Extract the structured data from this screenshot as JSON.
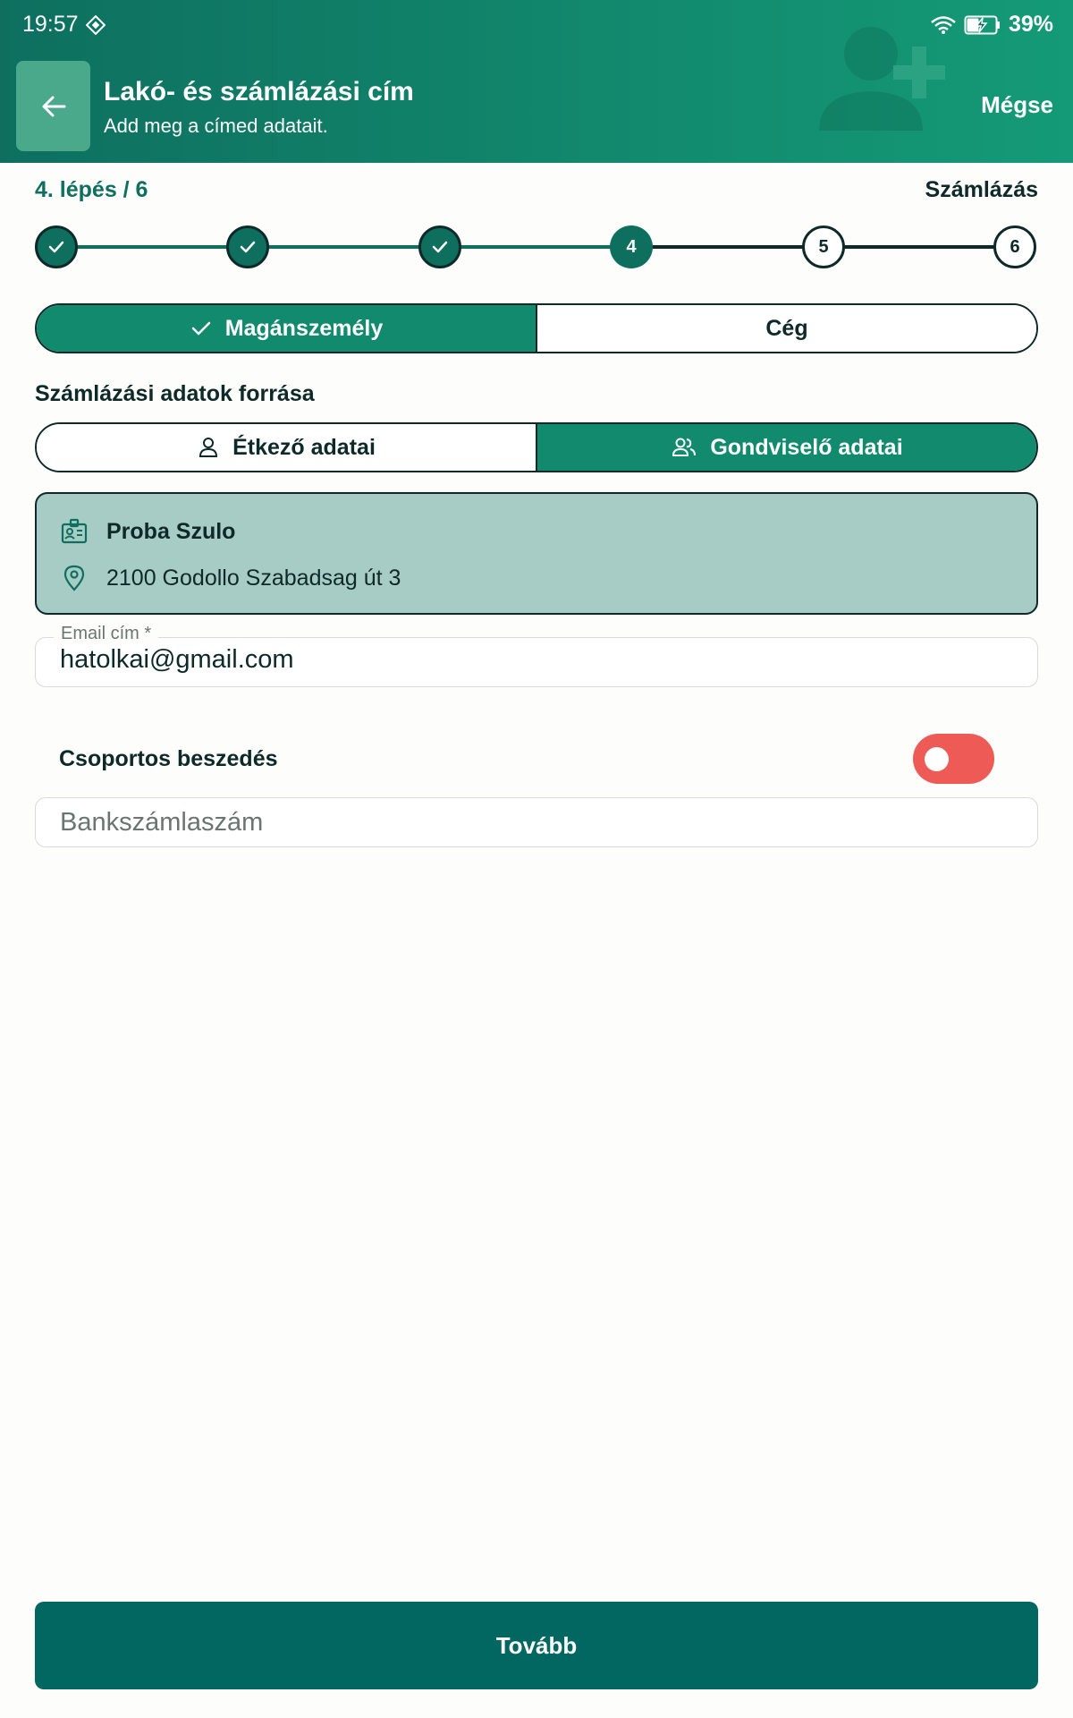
{
  "status_bar": {
    "time": "19:57",
    "battery": "39%"
  },
  "header": {
    "title": "Lakó- és számlázási cím",
    "subtitle": "Add meg a címed adatait.",
    "cancel_label": "Mégse"
  },
  "progress": {
    "step_label": "4. lépés / 6",
    "step_name": "Számlázás",
    "current": 4,
    "total": 6,
    "steps": [
      "",
      "",
      "",
      "4",
      "5",
      "6"
    ]
  },
  "customer_type": {
    "options": [
      "Magánszemély",
      "Cég"
    ],
    "selected": "Magánszemély"
  },
  "billing_source": {
    "label": "Számlázási adatok forrása",
    "options": [
      "Étkező adatai",
      "Gondviselő adatai"
    ],
    "selected": "Gondviselő adatai"
  },
  "billing_card": {
    "name": "Proba Szulo",
    "address": "2100 Godollo Szabadsag út 3"
  },
  "email": {
    "label": "Email cím *",
    "value": "hatolkai@gmail.com"
  },
  "group_billing": {
    "label": "Csoportos beszedés",
    "enabled": false
  },
  "bank_account": {
    "placeholder": "Bankszámlaszám"
  },
  "next_label": "Tovább",
  "colors": {
    "primary": "#0e6f5f",
    "accent": "#128a6e",
    "card": "#a7cbc5",
    "toggle_off": "#ee5a55",
    "button": "#016760"
  }
}
